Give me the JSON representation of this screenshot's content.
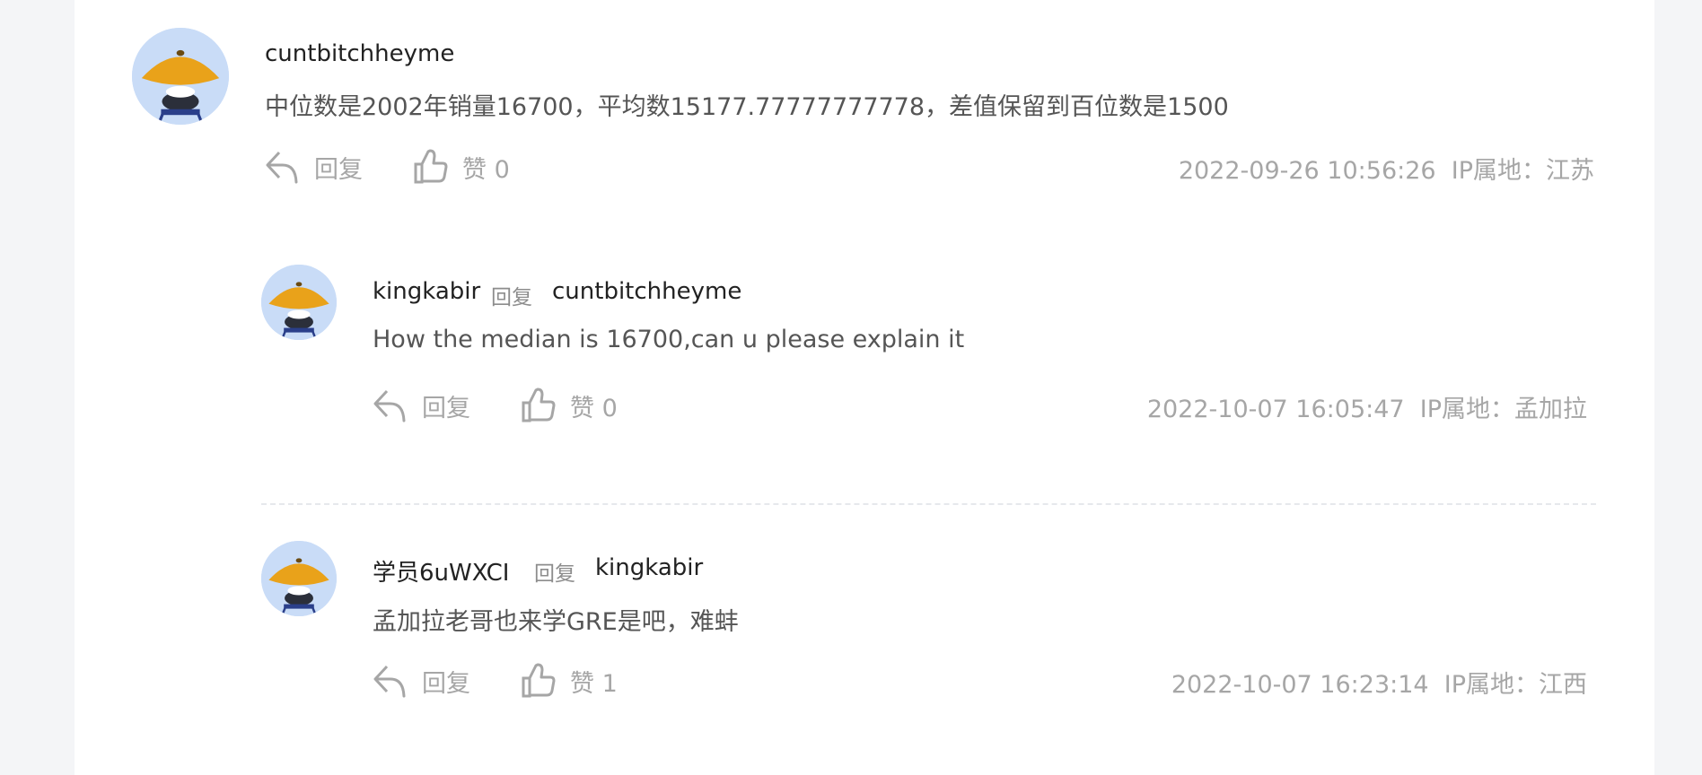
{
  "comments": [
    {
      "username": "cuntbitchheyme",
      "text": "中位数是2002年销量16700，平均数15177.77777777778，差值保留到百位数是1500",
      "reply_label": "回复",
      "like_label": "赞 0",
      "timestamp": "2022-09-26 10:56:26",
      "ip_location": "IP属地：江苏"
    },
    {
      "username": "kingkabir",
      "reply_word": "回复",
      "reply_to": "cuntbitchheyme",
      "text": "How the median is 16700,can u please explain it",
      "reply_label": "回复",
      "like_label": "赞 0",
      "timestamp": "2022-10-07 16:05:47",
      "ip_location": "IP属地：孟加拉"
    },
    {
      "username": "学员6uWXCI",
      "reply_word": "回复",
      "reply_to": "kingkabir",
      "text": "孟加拉老哥也来学GRE是吧，难蚌",
      "reply_label": "回复",
      "like_label": "赞 1",
      "timestamp": "2022-10-07 16:23:14",
      "ip_location": "IP属地：江西"
    }
  ],
  "icons": {
    "reply": "reply-arrow-icon",
    "like": "thumbs-up-icon",
    "avatar": "straw-hat-avatar"
  },
  "colors": {
    "avatar_bg": "#c9dcf7",
    "hat": "#e9a21a",
    "muted_text": "#a6a6a6",
    "username_text": "#222222"
  }
}
